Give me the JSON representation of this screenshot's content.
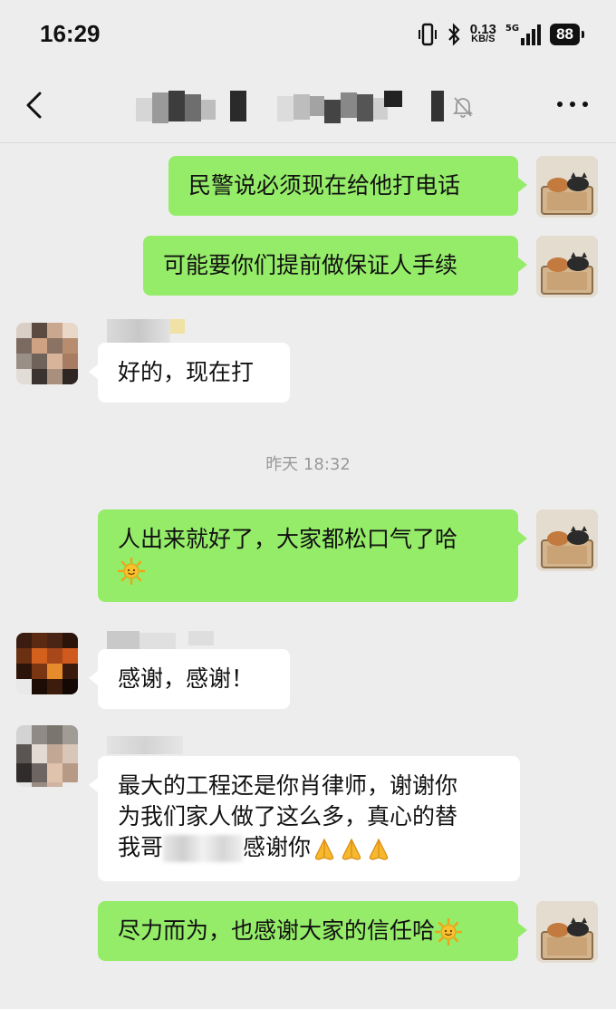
{
  "status_bar": {
    "time": "16:29",
    "net_speed_value": "0.13",
    "net_speed_unit": "KB/S",
    "signal_label": "5G",
    "battery": "88"
  },
  "header": {
    "title": "",
    "muted": true
  },
  "messages": [
    {
      "from": "me",
      "text": "民警说必须现在给他打电话"
    },
    {
      "from": "me",
      "text": "可能要你们提前做保证人手续"
    },
    {
      "from": "other",
      "text": "好的，现在打"
    },
    {
      "timestamp": "昨天 18:32"
    },
    {
      "from": "me",
      "text_line1": "人出来就好了，大家都松口气了哈",
      "emoji": "sun-emoji"
    },
    {
      "from": "other",
      "text": "感谢，感谢！"
    },
    {
      "from": "other",
      "line1": "最大的工程还是你肖律师，谢谢你",
      "line2": "为我们家人做了这么多，真心的替",
      "line3_a": "我哥",
      "line3_b": "感谢你",
      "emoji": "pray-emoji"
    },
    {
      "from": "me",
      "text": "尽力而为，也感谢大家的信任哈",
      "emoji": "sun-emoji"
    }
  ],
  "colors": {
    "background": "#ededed",
    "sent_bubble": "#95ec69",
    "received_bubble": "#ffffff"
  }
}
